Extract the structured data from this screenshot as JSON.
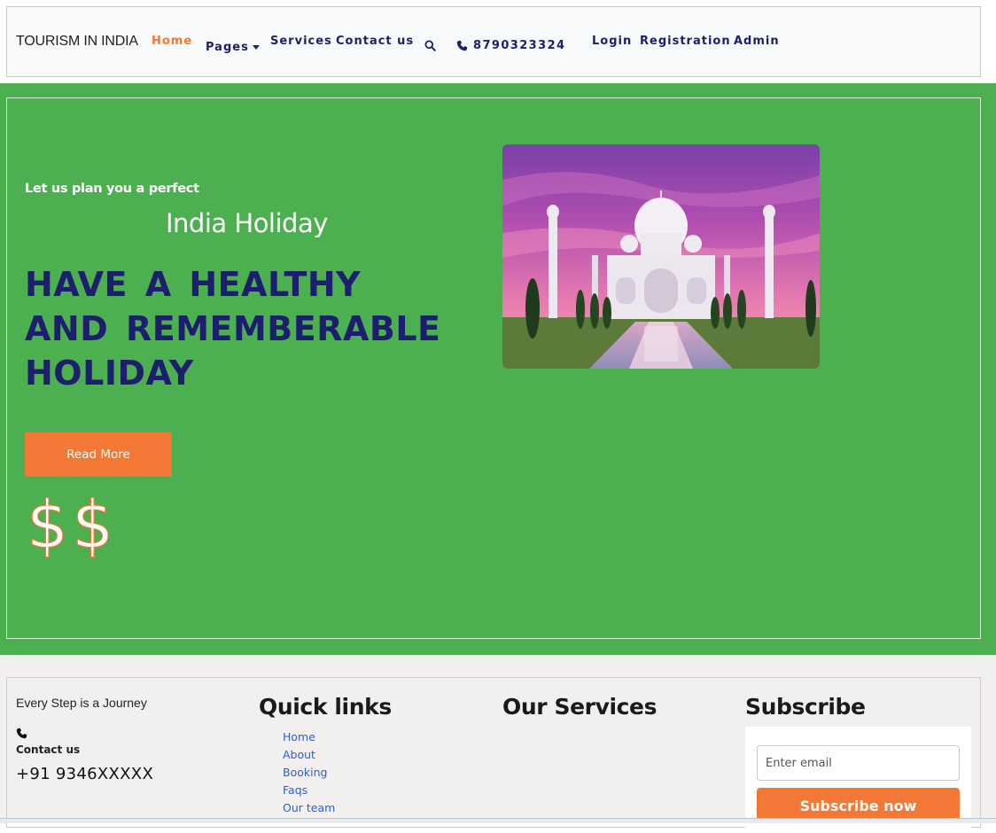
{
  "navbar": {
    "brand": "TOURISM IN INDIA",
    "links": {
      "home": "Home",
      "pages": "Pages",
      "services": "Services",
      "contact": "Contact us",
      "login": "Login",
      "registration": "Registration",
      "admin": "Admin"
    },
    "phone": "8790323324",
    "active_color": "#f37735",
    "link_color": "#1e1e6e"
  },
  "hero": {
    "tagline": "Let us plan you a perfect",
    "subtitle": "India Holiday",
    "headline": "HAVE A HEALTHY AND REMEMBERABLE HOLIDAY",
    "cta_label": "Read More",
    "price_symbol": "$$",
    "image_subject": "taj-mahal",
    "bg_color": "#4caf50"
  },
  "footer": {
    "tagline": "Every Step is a Journey",
    "contact_label": "Contact us",
    "contact_number": "+91 9346XXXXX",
    "quick_links_heading": "Quick links",
    "quick_links": [
      "Home",
      "About",
      "Booking",
      "Faqs",
      "Our team"
    ],
    "services_heading": "Our Services",
    "subscribe_heading": "Subscribe",
    "email_placeholder": "Enter email",
    "subscribe_button": "Subscribe now",
    "accent_color": "#f37735"
  }
}
